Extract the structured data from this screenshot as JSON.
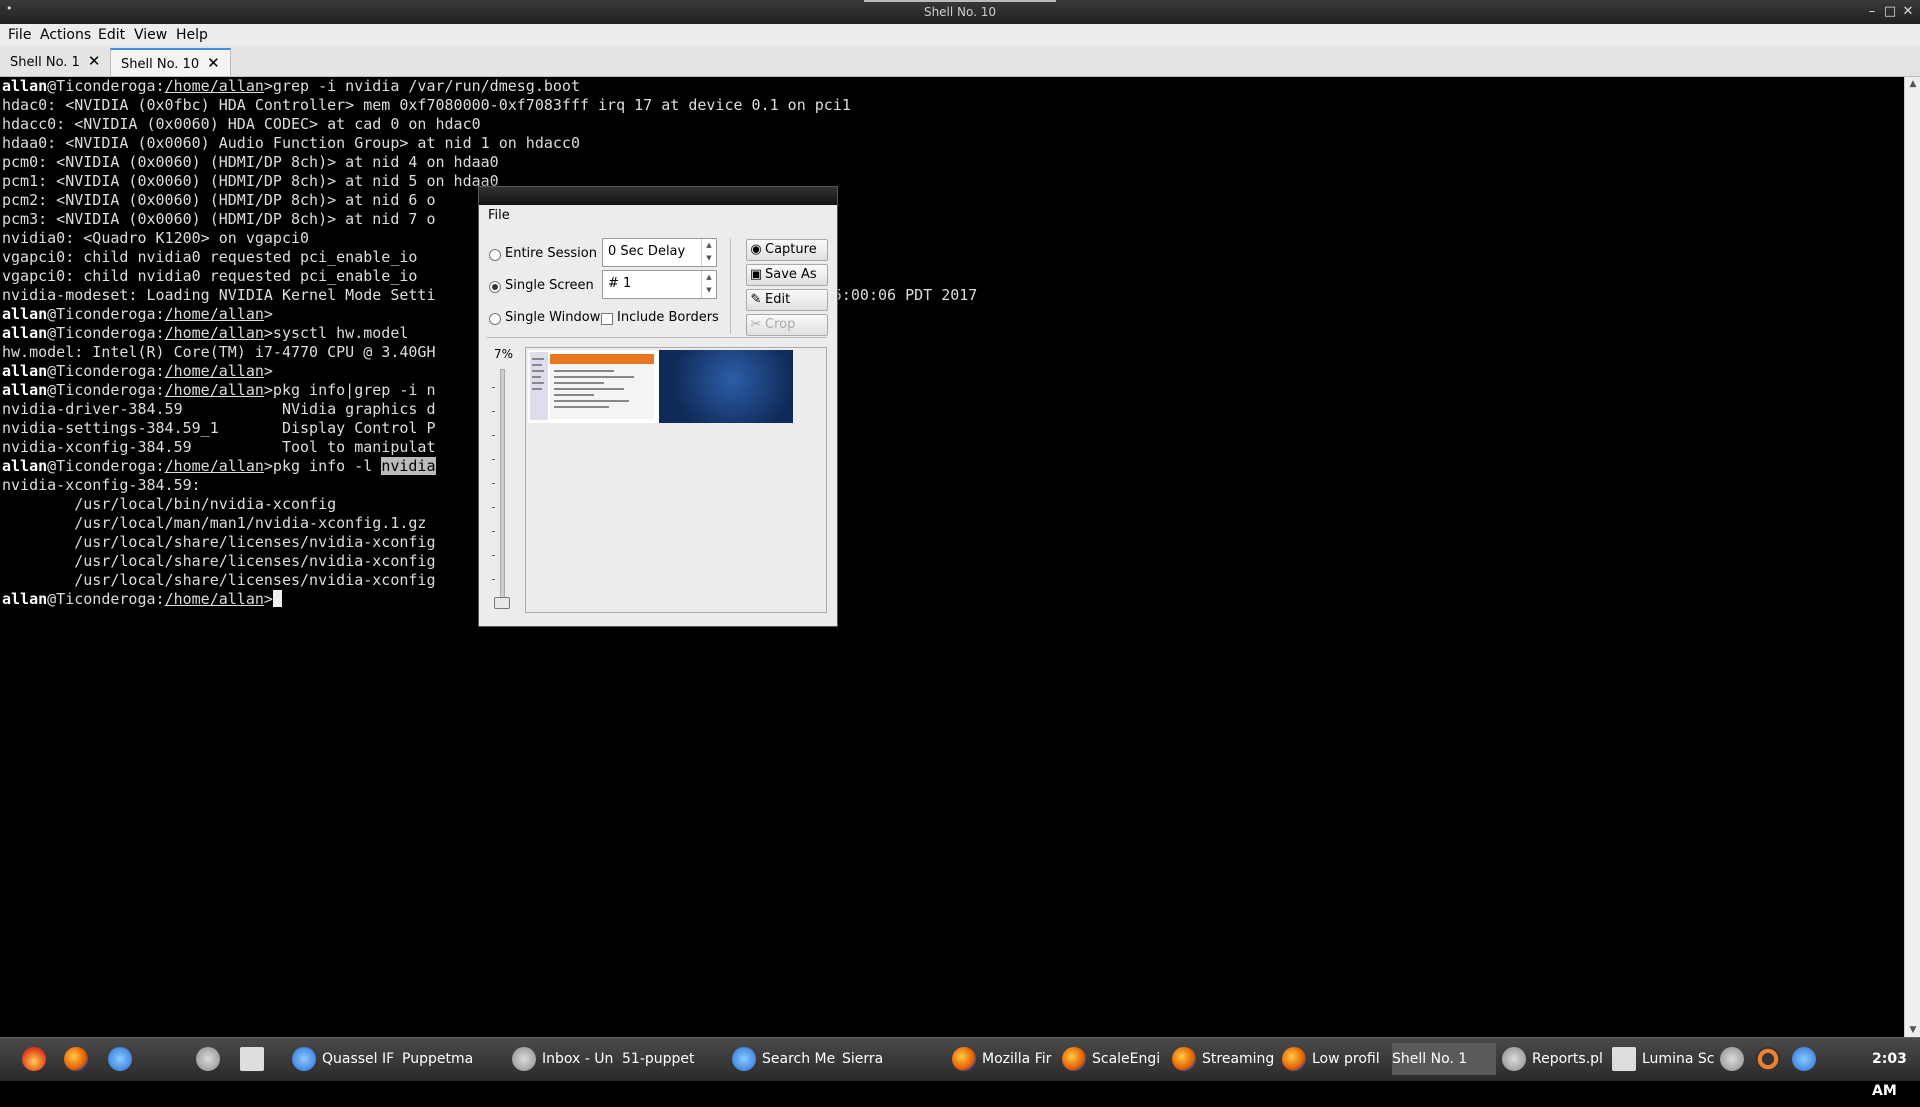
{
  "window": {
    "title": "Shell No. 10",
    "sysmenu": "•",
    "controls": [
      "–",
      "□",
      "✕"
    ]
  },
  "menubar": [
    "File",
    "Actions",
    "Edit",
    "View",
    "Help"
  ],
  "tabs": [
    {
      "label": "Shell No. 1"
    },
    {
      "label": "Shell No. 10",
      "active": true
    }
  ],
  "terminal": {
    "user": "allan",
    "host_prompt": "@Ticonderoga:",
    "cwd": "/home/allan",
    "prompt_end": ">",
    "lines": [
      {
        "type": "prompt",
        "cmd": "grep -i nvidia /var/run/dmesg.boot"
      },
      {
        "type": "out",
        "text": "hdac0: <NVIDIA (0x0fbc) HDA Controller> mem 0xf7080000-0xf7083fff irq 17 at device 0.1 on pci1"
      },
      {
        "type": "out",
        "text": "hdacc0: <NVIDIA (0x0060) HDA CODEC> at cad 0 on hdac0"
      },
      {
        "type": "out",
        "text": "hdaa0: <NVIDIA (0x0060) Audio Function Group> at nid 1 on hdacc0"
      },
      {
        "type": "out",
        "text": "pcm0: <NVIDIA (0x0060) (HDMI/DP 8ch)> at nid 4 on hdaa0"
      },
      {
        "type": "out",
        "text": "pcm1: <NVIDIA (0x0060) (HDMI/DP 8ch)> at nid 5 on hdaa0"
      },
      {
        "type": "out",
        "text": "pcm2: <NVIDIA (0x0060) (HDMI/DP 8ch)> at nid 6 o"
      },
      {
        "type": "out",
        "text": "pcm3: <NVIDIA (0x0060) (HDMI/DP 8ch)> at nid 7 o"
      },
      {
        "type": "out",
        "text": "nvidia0: <Quadro K1200> on vgapci0"
      },
      {
        "type": "out",
        "text": "vgapci0: child nvidia0 requested pci_enable_io"
      },
      {
        "type": "out",
        "text": "vgapci0: child nvidia0 requested pci_enable_io"
      },
      {
        "type": "out",
        "text": "nvidia-modeset: Loading NVIDIA Kernel Mode Setti                             5  Mon May  1 15:00:06 PDT 2017"
      },
      {
        "type": "prompt",
        "cmd": ""
      },
      {
        "type": "prompt",
        "cmd": "sysctl hw.model"
      },
      {
        "type": "out",
        "text": "hw.model: Intel(R) Core(TM) i7-4770 CPU @ 3.40GH"
      },
      {
        "type": "prompt",
        "cmd": ""
      },
      {
        "type": "prompt",
        "cmd": "pkg info|grep -i n"
      },
      {
        "type": "out",
        "text": "nvidia-driver-384.59           NVidia graphics d                             nGL rendering"
      },
      {
        "type": "out",
        "text": "nvidia-settings-384.59_1       Display Control P"
      },
      {
        "type": "out",
        "text": "nvidia-xconfig-384.59          Tool to manipulat                             dia driver"
      },
      {
        "type": "prompt",
        "cmd": "pkg info -l ",
        "sel": "nvidia"
      },
      {
        "type": "out",
        "text": "nvidia-xconfig-384.59:"
      },
      {
        "type": "out",
        "text": "        /usr/local/bin/nvidia-xconfig"
      },
      {
        "type": "out",
        "text": "        /usr/local/man/man1/nvidia-xconfig.1.gz"
      },
      {
        "type": "out",
        "text": "        /usr/local/share/licenses/nvidia-xconfig"
      },
      {
        "type": "out",
        "text": "        /usr/local/share/licenses/nvidia-xconfig"
      },
      {
        "type": "out",
        "text": "        /usr/local/share/licenses/nvidia-xconfig"
      },
      {
        "type": "prompt",
        "cmd": "",
        "cursor": true
      }
    ]
  },
  "dialog": {
    "menu": "File",
    "entire_session": "Entire Session",
    "single_screen": "Single Screen",
    "single_window": "Single Window",
    "include_borders": "Include Borders",
    "delay": "0 Sec Delay",
    "screen": "# 1",
    "capture": "Capture",
    "save_as": "Save As",
    "edit": "Edit",
    "crop": "Crop",
    "zoom": "7%",
    "selected_mode": "single_screen"
  },
  "taskbar": {
    "launchers": [
      "flame-icon",
      "firefox-icon",
      "thunderbird-icon",
      "terminal-icon",
      "settings-icon",
      "window-icon"
    ],
    "tasks": [
      {
        "label": "Quassel IF",
        "icon": "blue"
      },
      {
        "label": "Puppetma",
        "icon": "term"
      },
      {
        "label": "Inbox - Un",
        "icon": "gray"
      },
      {
        "label": "51-puppet",
        "icon": "term"
      },
      {
        "label": "Search Me",
        "icon": "blue"
      },
      {
        "label": "Sierra",
        "icon": "term"
      },
      {
        "label": "Mozilla Fir",
        "icon": "ff"
      },
      {
        "label": "ScaleEngi",
        "icon": "ff"
      },
      {
        "label": "Streaming",
        "icon": "ff"
      },
      {
        "label": "Low profil",
        "icon": "ff"
      },
      {
        "label": "Shell No. 1",
        "icon": "term",
        "active": true
      },
      {
        "label": "Reports.pl",
        "icon": "gray"
      },
      {
        "label": "Lumina Sc",
        "icon": "win"
      }
    ],
    "clock": "2:03 AM"
  }
}
